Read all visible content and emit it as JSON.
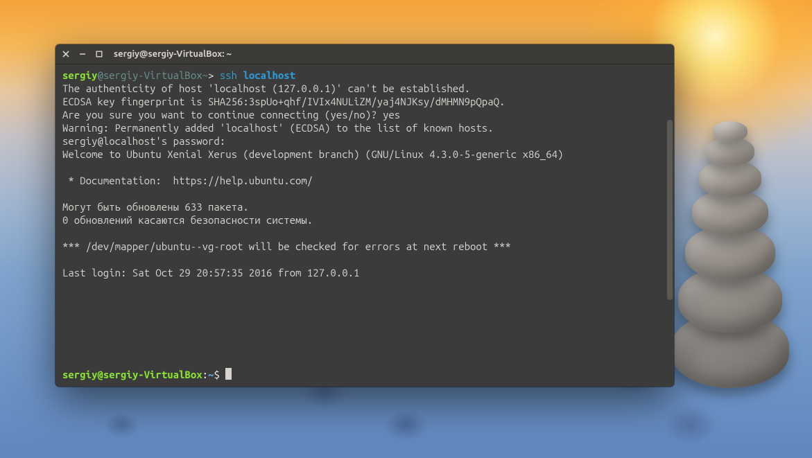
{
  "window": {
    "title": "sergiy@sergiy-VirtualBox: ~"
  },
  "prompt1": {
    "user": "sergiy",
    "at": "@",
    "host": "sergiy-VirtualBox",
    "tilde": "~",
    "sep": ">",
    "command": "ssh",
    "arg": "localhost"
  },
  "lines": {
    "l1": "The authenticity of host 'localhost (127.0.0.1)' can't be established.",
    "l2": "ECDSA key fingerprint is SHA256:3spUo+qhf/IVIx4NULiZM/yaj4NJKsy/dMHMN9pQpaQ.",
    "l3": "Are you sure you want to continue connecting (yes/no)? yes",
    "l4": "Warning: Permanently added 'localhost' (ECDSA) to the list of known hosts.",
    "l5": "sergiy@localhost's password:",
    "l6": "Welcome to Ubuntu Xenial Xerus (development branch) (GNU/Linux 4.3.0-5-generic x86_64)",
    "l7": "",
    "l8": " * Documentation:  https://help.ubuntu.com/",
    "l9": "",
    "l10": "Могут быть обновлены 633 пакета.",
    "l11": "0 обновлений касаются безопасности системы.",
    "l12": "",
    "l13": "*** /dev/mapper/ubuntu--vg-root will be checked for errors at next reboot ***",
    "l14": "",
    "l15": "Last login: Sat Oct 29 20:57:35 2016 from 127.0.0.1"
  },
  "prompt2": {
    "user": "sergiy",
    "at": "@",
    "host": "sergiy-VirtualBox",
    "colon": ":",
    "path": "~",
    "dollar": "$ "
  }
}
